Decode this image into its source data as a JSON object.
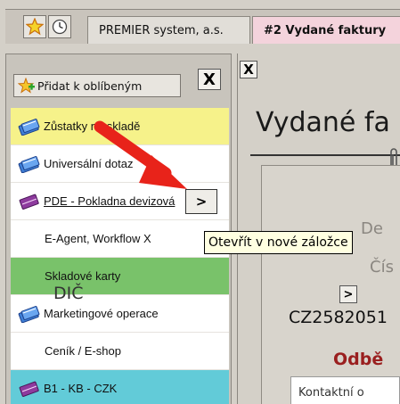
{
  "tabs": {
    "first_label": "PREMIER system, a.s.",
    "active_label": "#2 Vydané faktury"
  },
  "left": {
    "fav_label": "Přidat k oblíbeným",
    "close_glyph": "X",
    "items": [
      {
        "label": "Zůstatky na skladě",
        "bg": "#f6f28a",
        "icon": "books-icon"
      },
      {
        "label": "Universální dotaz",
        "bg": "#ffffff",
        "icon": "books-icon"
      },
      {
        "label": "PDE - Pokladna devizová",
        "bg": "#ffffff",
        "icon": "book-purple-icon"
      },
      {
        "label": "E-Agent, Workflow X",
        "bg": "#ffffff",
        "icon": ""
      },
      {
        "label": "Skladové karty",
        "bg": "#79c26a",
        "icon": ""
      },
      {
        "label": "Marketingové operace",
        "bg": "#ffffff",
        "icon": "books-icon"
      },
      {
        "label": "Ceník / E-shop",
        "bg": "#ffffff",
        "icon": ""
      },
      {
        "label": "B1  - KB  - CZK",
        "bg": "#62cbd8",
        "icon": "book-purple-icon"
      }
    ]
  },
  "right": {
    "close_glyph": "X",
    "title": "Vydané fa",
    "dim1": "De",
    "dim2": "Čís",
    "dic_label": "DIČ",
    "dic_value": "CZ2582051",
    "odberatel": "Odbě",
    "kontakt": "Kontaktní o"
  },
  "open_btn_glyph": ">",
  "tooltip": "Otevřít v nové záložce"
}
